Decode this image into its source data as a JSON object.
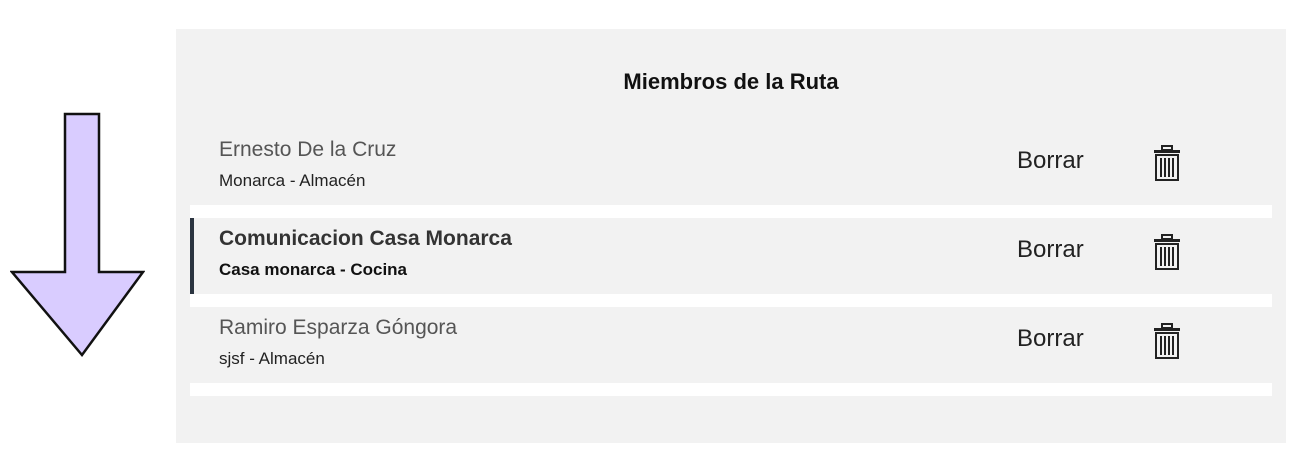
{
  "panel": {
    "title": "Miembros de la Ruta"
  },
  "members": [
    {
      "name": "Ernesto De la Cruz",
      "detail": "Monarca - Almacén",
      "delete_label": "Borrar",
      "selected": false
    },
    {
      "name": "Comunicacion Casa Monarca",
      "detail": "Casa monarca - Cocina",
      "delete_label": "Borrar",
      "selected": true
    },
    {
      "name": "Ramiro Esparza Góngora",
      "detail": "sjsf - Almacén",
      "delete_label": "Borrar",
      "selected": false
    }
  ],
  "icons": {
    "arrow": "down-arrow-icon",
    "delete": "trash-icon"
  },
  "colors": {
    "arrow_fill": "#d9ccff",
    "panel_bg": "#f2f2f2",
    "accent": "#2b3440"
  }
}
